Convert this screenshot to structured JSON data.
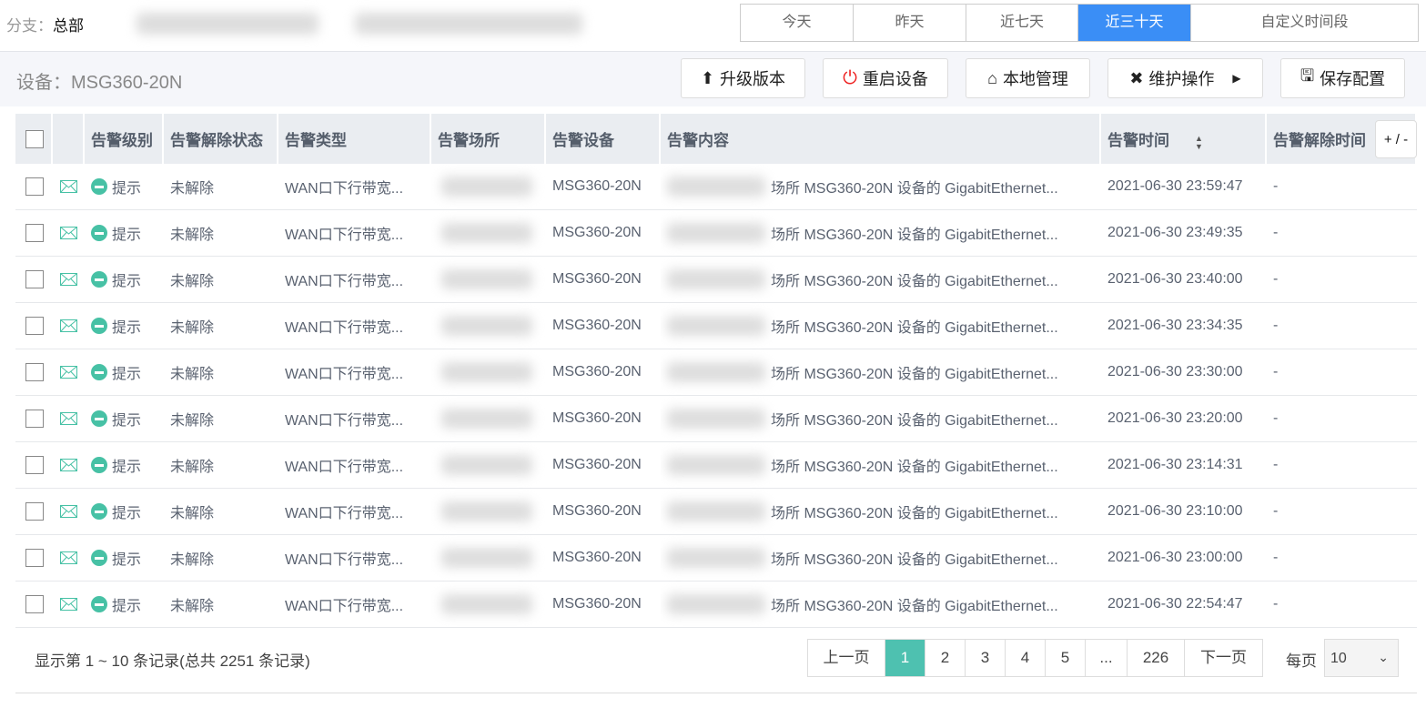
{
  "branch": {
    "label": "分支：",
    "value": "总部"
  },
  "date_tabs": [
    {
      "label": "今天",
      "active": false
    },
    {
      "label": "昨天",
      "active": false
    },
    {
      "label": "近七天",
      "active": false
    },
    {
      "label": "近三十天",
      "active": true
    },
    {
      "label": "自定义时间段",
      "active": false
    }
  ],
  "device": {
    "title": "设备：MSG360-20N"
  },
  "toolbar": {
    "upgrade": "升级版本",
    "reboot": "重启设备",
    "local": "本地管理",
    "maintain": "维护操作",
    "save": "保存配置"
  },
  "table": {
    "headers": [
      "告警级别",
      "告警解除状态",
      "告警类型",
      "告警场所",
      "告警设备",
      "告警内容",
      "告警时间",
      "告警解除时间"
    ],
    "column_toggle": "+ / -",
    "rows": [
      {
        "level": "提示",
        "status": "未解除",
        "type": "WAN口下行带宽...",
        "device": "MSG360-20N",
        "content": "场所 MSG360-20N 设备的 GigabitEthernet...",
        "time": "2021-06-30 23:59:47",
        "clear": "-"
      },
      {
        "level": "提示",
        "status": "未解除",
        "type": "WAN口下行带宽...",
        "device": "MSG360-20N",
        "content": "场所 MSG360-20N 设备的 GigabitEthernet...",
        "time": "2021-06-30 23:49:35",
        "clear": "-"
      },
      {
        "level": "提示",
        "status": "未解除",
        "type": "WAN口下行带宽...",
        "device": "MSG360-20N",
        "content": "场所 MSG360-20N 设备的 GigabitEthernet...",
        "time": "2021-06-30 23:40:00",
        "clear": "-"
      },
      {
        "level": "提示",
        "status": "未解除",
        "type": "WAN口下行带宽...",
        "device": "MSG360-20N",
        "content": "场所 MSG360-20N 设备的 GigabitEthernet...",
        "time": "2021-06-30 23:34:35",
        "clear": "-"
      },
      {
        "level": "提示",
        "status": "未解除",
        "type": "WAN口下行带宽...",
        "device": "MSG360-20N",
        "content": "场所 MSG360-20N 设备的 GigabitEthernet...",
        "time": "2021-06-30 23:30:00",
        "clear": "-"
      },
      {
        "level": "提示",
        "status": "未解除",
        "type": "WAN口下行带宽...",
        "device": "MSG360-20N",
        "content": "场所 MSG360-20N 设备的 GigabitEthernet...",
        "time": "2021-06-30 23:20:00",
        "clear": "-"
      },
      {
        "level": "提示",
        "status": "未解除",
        "type": "WAN口下行带宽...",
        "device": "MSG360-20N",
        "content": "场所 MSG360-20N 设备的 GigabitEthernet...",
        "time": "2021-06-30 23:14:31",
        "clear": "-"
      },
      {
        "level": "提示",
        "status": "未解除",
        "type": "WAN口下行带宽...",
        "device": "MSG360-20N",
        "content": "场所 MSG360-20N 设备的 GigabitEthernet...",
        "time": "2021-06-30 23:10:00",
        "clear": "-"
      },
      {
        "level": "提示",
        "status": "未解除",
        "type": "WAN口下行带宽...",
        "device": "MSG360-20N",
        "content": "场所 MSG360-20N 设备的 GigabitEthernet...",
        "time": "2021-06-30 23:00:00",
        "clear": "-"
      },
      {
        "level": "提示",
        "status": "未解除",
        "type": "WAN口下行带宽...",
        "device": "MSG360-20N",
        "content": "场所 MSG360-20N 设备的 GigabitEthernet...",
        "time": "2021-06-30 22:54:47",
        "clear": "-"
      }
    ]
  },
  "footer": {
    "summary": "显示第 1 ~ 10 条记录(总共 2251 条记录)",
    "pages": [
      "上一页",
      "1",
      "2",
      "3",
      "4",
      "5",
      "...",
      "226",
      "下一页"
    ],
    "active_page": "1",
    "per_page_label": "每页",
    "per_page_value": "10"
  },
  "colors": {
    "accent": "#3a8ef6",
    "level_hint": "#47c1a5",
    "page_active": "#4ec1b0"
  }
}
